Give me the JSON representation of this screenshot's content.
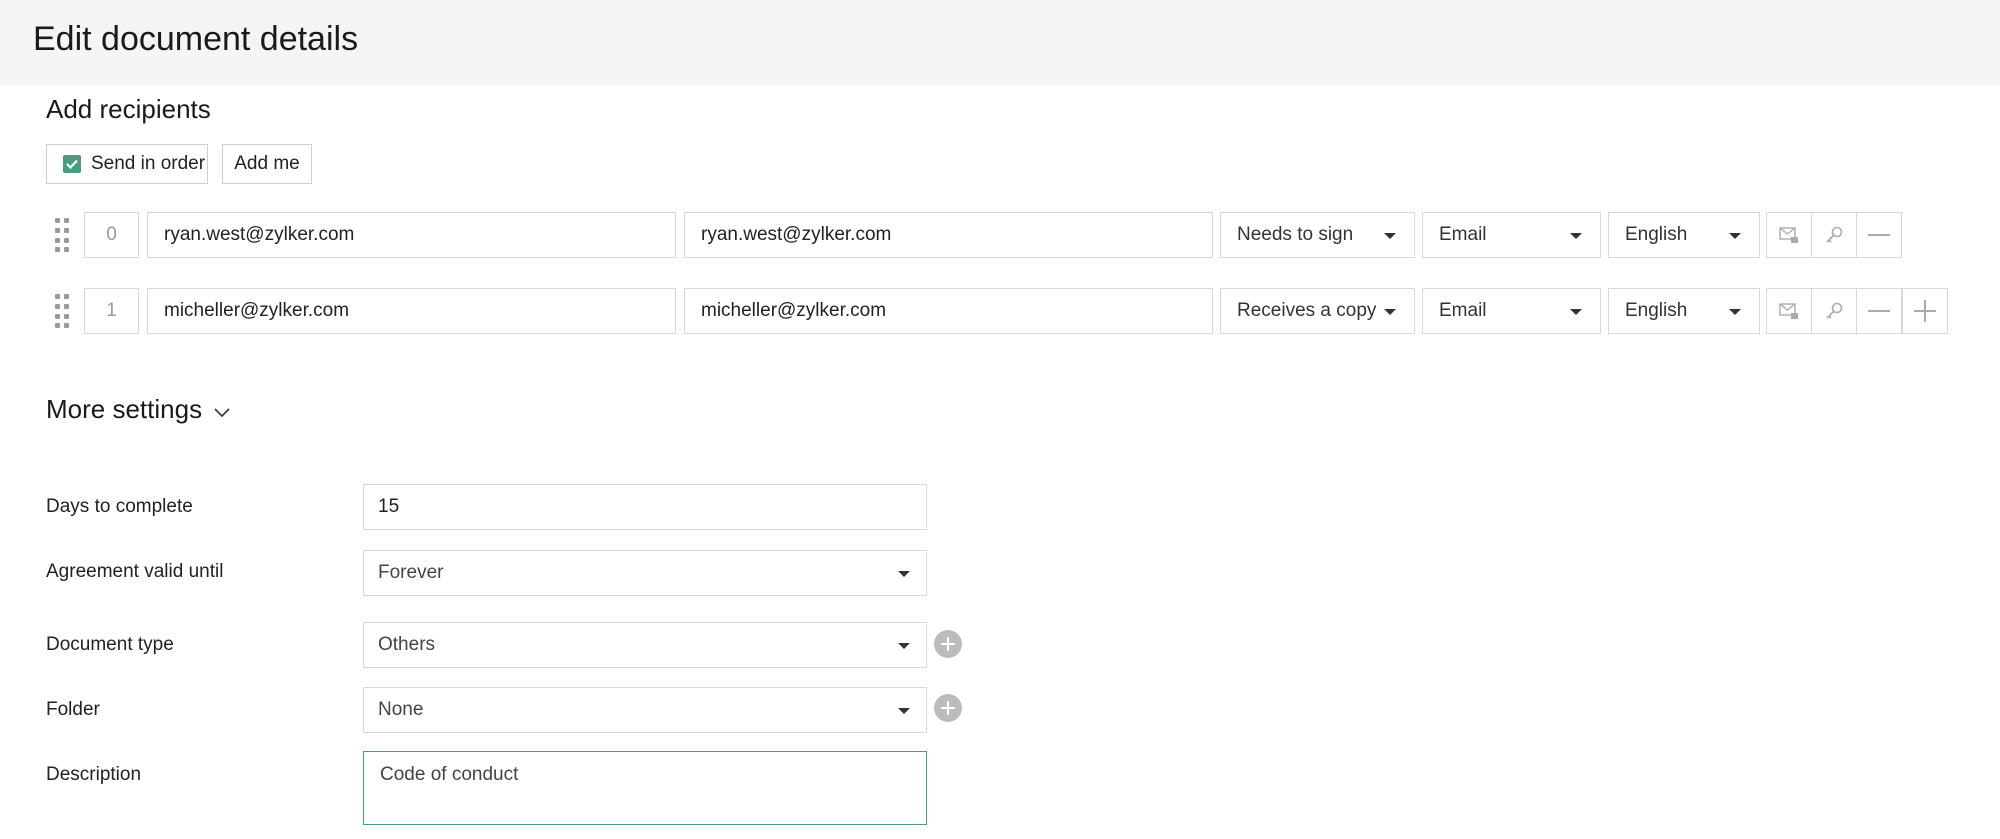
{
  "header": {
    "title": "Edit document details"
  },
  "recipients": {
    "title": "Add recipients",
    "send_in_order_label": "Send in order",
    "send_in_order_checked": true,
    "add_me_label": "Add me",
    "rows": [
      {
        "order": "0",
        "email": "ryan.west@zylker.com",
        "name": "ryan.west@zylker.com",
        "role": "Needs to sign",
        "delivery": "Email",
        "language": "English"
      },
      {
        "order": "1",
        "email": "micheller@zylker.com",
        "name": "micheller@zylker.com",
        "role": "Receives a copy",
        "delivery": "Email",
        "language": "English"
      }
    ]
  },
  "more_settings": {
    "title": "More settings",
    "days_label": "Days to complete",
    "days_value": "15",
    "validity_label": "Agreement valid until",
    "validity_value": "Forever",
    "doctype_label": "Document type",
    "doctype_value": "Others",
    "folder_label": "Folder",
    "folder_value": "None",
    "description_label": "Description",
    "description_value": "Code of conduct"
  },
  "colors": {
    "accent": "#4a9d83",
    "header_bg": "#f5f5f5"
  },
  "icons": [
    "drag-handle-icon",
    "mail-lock-icon",
    "key-icon",
    "minus-icon",
    "plus-icon",
    "chevron-down-icon",
    "add-circle-icon",
    "checkmark-icon"
  ]
}
